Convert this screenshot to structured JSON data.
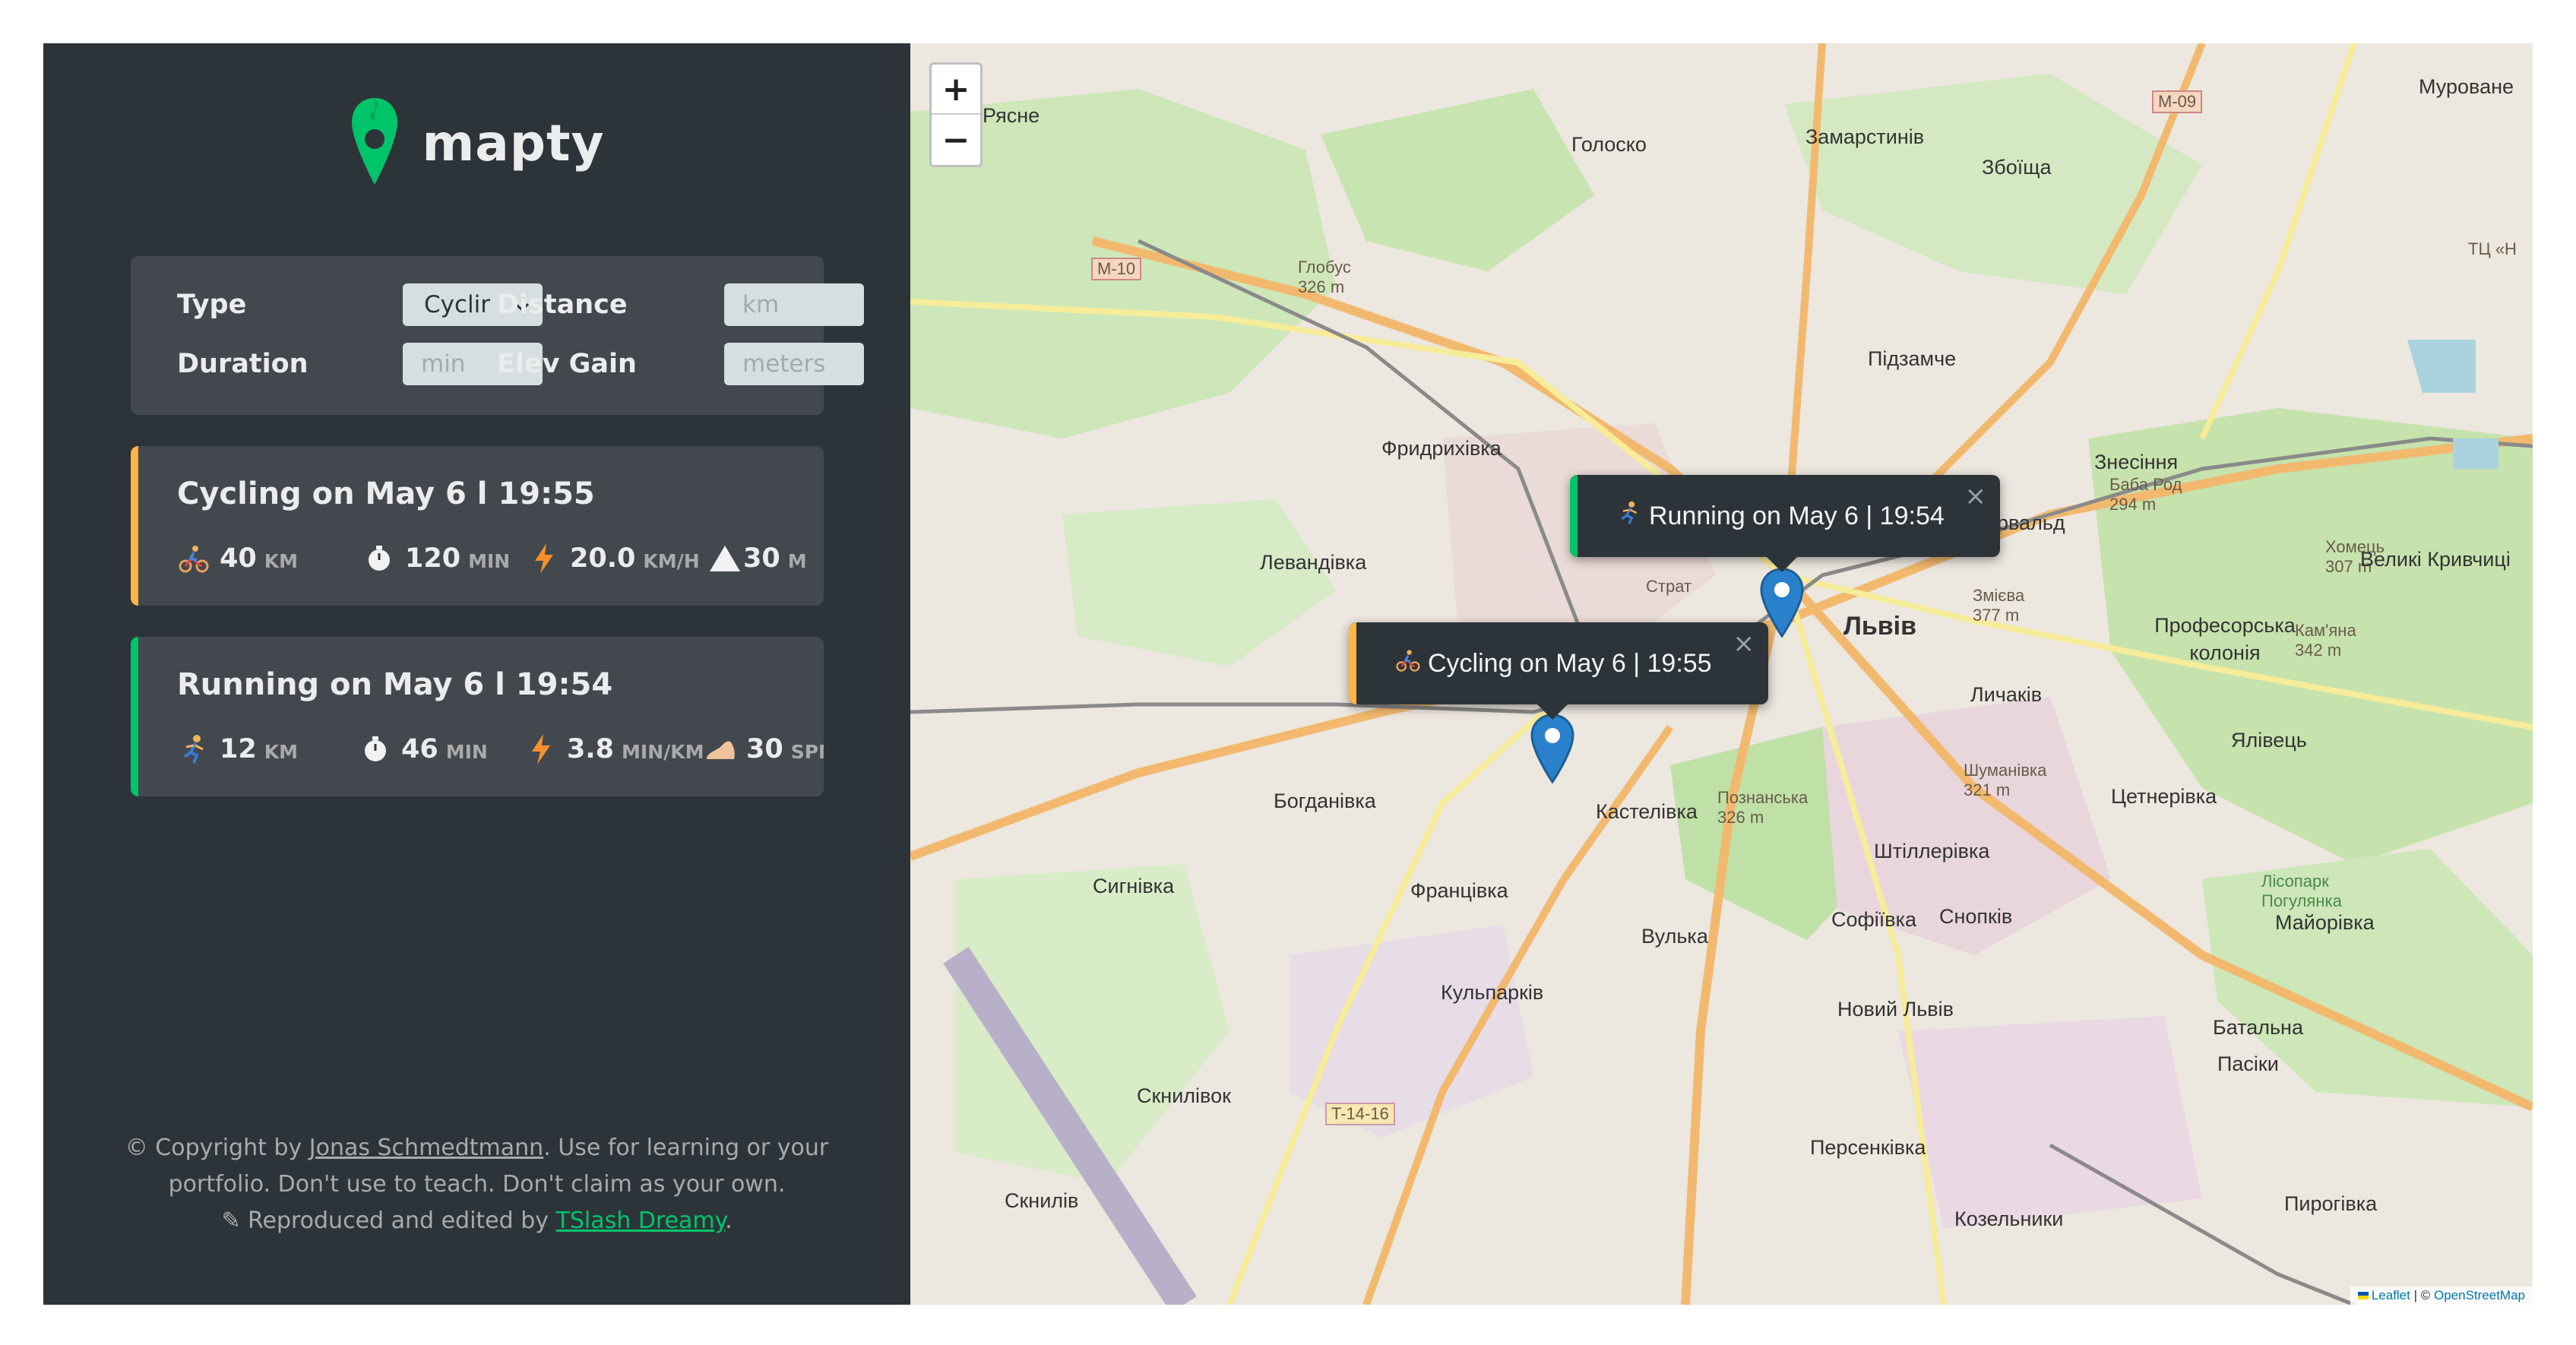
{
  "app": {
    "name": "mapty"
  },
  "colors": {
    "cycling": "#ffb545",
    "running": "#00c46a",
    "sidebar": "#2d3439",
    "card": "#42484d"
  },
  "form": {
    "type_label": "Type",
    "type_value": "Cyclir",
    "distance_label": "Distance",
    "distance_placeholder": "km",
    "duration_label": "Duration",
    "duration_placeholder": "min",
    "elev_label": "Elev Gain",
    "elev_placeholder": "meters"
  },
  "workouts": [
    {
      "title": "Cycling on May 6 l 19:55",
      "stats": [
        {
          "icon": "cyclist-icon",
          "value": "40",
          "unit": "KM"
        },
        {
          "icon": "stopwatch-icon",
          "value": "120",
          "unit": "MIN"
        },
        {
          "icon": "lightning-icon",
          "value": "20.0",
          "unit": "KM/H"
        },
        {
          "icon": "mountain-icon",
          "value": "30",
          "unit": "M"
        }
      ]
    },
    {
      "title": "Running on May 6 l 19:54",
      "stats": [
        {
          "icon": "runner-icon",
          "value": "12",
          "unit": "KM"
        },
        {
          "icon": "stopwatch-icon",
          "value": "46",
          "unit": "MIN"
        },
        {
          "icon": "lightning-icon",
          "value": "3.8",
          "unit": "MIN/KM"
        },
        {
          "icon": "footprint-icon",
          "value": "30",
          "unit": "SPM"
        }
      ]
    }
  ],
  "copyright": {
    "prefix": "© Copyright by ",
    "author": "Jonas Schmedtmann",
    "middle": ". Use for learning or your",
    "line2": "portfolio. Don't use to teach. Don't claim as your own.",
    "line3_prefix": "✎ Reproduced and edited by ",
    "editor": "TSlash Dreamy",
    "line3_suffix": "."
  },
  "map": {
    "zoom_in": "+",
    "zoom_out": "−",
    "popups": [
      {
        "text": "Running on May 6 | 19:54",
        "icon": "runner-icon",
        "close": "×"
      },
      {
        "text": "Cycling on May 6 | 19:55",
        "icon": "cyclist-icon",
        "close": "×"
      }
    ],
    "attribution_leaflet": "Leaflet",
    "attribution_sep": " | © ",
    "attribution_osm": "OpenStreetMap",
    "places": [
      "Рясне",
      "Голоско",
      "Замарстинів",
      "Збоїща",
      "Муроване",
      "Глобус 326 m",
      "Підзамче",
      "Фридрихівка",
      "Знесіння",
      "Баба Род 294 m",
      "Левандівка",
      "Страт",
      "Львів",
      "Хомець 307 m",
      "Великі Кривчиці",
      "Змієва 377 m",
      "Професорська колонія",
      "Кам'яна 342 m",
      "Личаків",
      "Ялівець",
      "Богданівка",
      "Кастелівка",
      "Познанська 326 m",
      "Шуманівка 321 m",
      "Цетнерівка",
      "Сигнівка",
      "Францівка",
      "Штіллерівка",
      "Софіївка",
      "Снопків",
      "Вулька",
      "Майорівка",
      "Кульпарків",
      "Новий Львів",
      "Батальна",
      "Пасіки",
      "Скнилівок",
      "Персенківка",
      "Скнилів",
      "Козельники",
      "Пирогівка",
      "M-09",
      "M-10",
      "T-14-16",
      "ТЦ «Н",
      "Лісопарк Погулянка",
      "рвальд"
    ]
  }
}
